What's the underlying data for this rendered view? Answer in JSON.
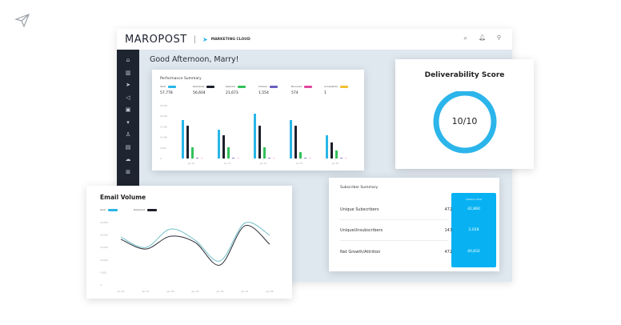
{
  "header": {
    "logo": "MAROPOST",
    "product": "MARKETING CLOUD",
    "icons": [
      "search-icon",
      "bell-icon",
      "location-pin-icon"
    ]
  },
  "sidebar": {
    "icons": [
      "home-icon",
      "bar-chart-icon",
      "paper-plane-icon",
      "megaphone-icon",
      "briefcase-icon",
      "funnel-icon",
      "user-icon",
      "image-icon",
      "cloud-icon",
      "cart-icon"
    ]
  },
  "greeting": "Good Afternoon, Marry!",
  "colors": {
    "sent": "#29b6e8",
    "delivered": "#1d1f2b",
    "opened": "#33c25b",
    "clicked": "#6a5fc0",
    "bounced": "#e0489e",
    "complaints": "#f2c12e",
    "accent": "#08b2f2"
  },
  "performance": {
    "title": "Performance Summary",
    "legend": [
      {
        "label": "Sent",
        "value": "57,778"
      },
      {
        "label": "Delivered",
        "value": "56,604"
      },
      {
        "label": "Opened",
        "value": "21,673"
      },
      {
        "label": "Clicked",
        "value": "1,554"
      },
      {
        "label": "Bounced",
        "value": "574"
      },
      {
        "label": "Complaints",
        "value": "1"
      }
    ]
  },
  "deliverability": {
    "title": "Deliverability Score",
    "score": "10/10",
    "fraction": 1.0
  },
  "subscriber": {
    "title": "Subscriber Summary",
    "total_header": "Lifetime Total",
    "rows": [
      {
        "label": "Unique Subscribers",
        "value": "472",
        "total": "42,860"
      },
      {
        "label": "UniqueUnsubscribers",
        "value": "143",
        "total": "2,028"
      },
      {
        "label": "Net Growth/Attrition",
        "value": "472",
        "total": "40,832"
      }
    ]
  },
  "chart_data": [
    {
      "type": "bar",
      "title": "Performance Summary",
      "categories": [
        "Jan 02",
        "Jan 03",
        "Jan 04",
        "Jan 05",
        "Jan 06"
      ],
      "yticks": [
        "25,000",
        "20,000",
        "15,000",
        "10,000",
        "5,000",
        "0"
      ],
      "ylim": [
        0,
        25000
      ],
      "grid": false,
      "series": [
        {
          "name": "Sent",
          "values": [
            18200,
            13600,
            21200,
            18200,
            11000
          ]
        },
        {
          "name": "Delivered",
          "values": [
            15500,
            11000,
            15500,
            15500,
            7600
          ]
        },
        {
          "name": "Opened",
          "values": [
            5300,
            5300,
            5300,
            3000,
            3800
          ]
        },
        {
          "name": "Clicked",
          "values": [
            300,
            300,
            300,
            300,
            300
          ]
        },
        {
          "name": "Bounced",
          "values": [
            100,
            100,
            100,
            100,
            100
          ]
        }
      ]
    },
    {
      "type": "line",
      "title": "Email Volume",
      "categories": [
        "Jan 02",
        "Jan 03",
        "Jan 04",
        "Jan 05",
        "Jan 06",
        "Jan 07",
        "Jan 08"
      ],
      "yticks": [
        "25,000",
        "20,000",
        "15,000",
        "10,000",
        "5,000",
        "0"
      ],
      "ylim": [
        0,
        25000
      ],
      "grid": false,
      "legend": "top-left",
      "series": [
        {
          "name": "Sent",
          "color": "#6fbfc9",
          "values": [
            19200,
            15000,
            22400,
            17900,
            9600,
            24800,
            19900
          ]
        },
        {
          "name": "Delivered",
          "color": "#2b2d36",
          "values": [
            18300,
            14400,
            19500,
            17000,
            8000,
            23700,
            16300
          ]
        }
      ]
    }
  ]
}
